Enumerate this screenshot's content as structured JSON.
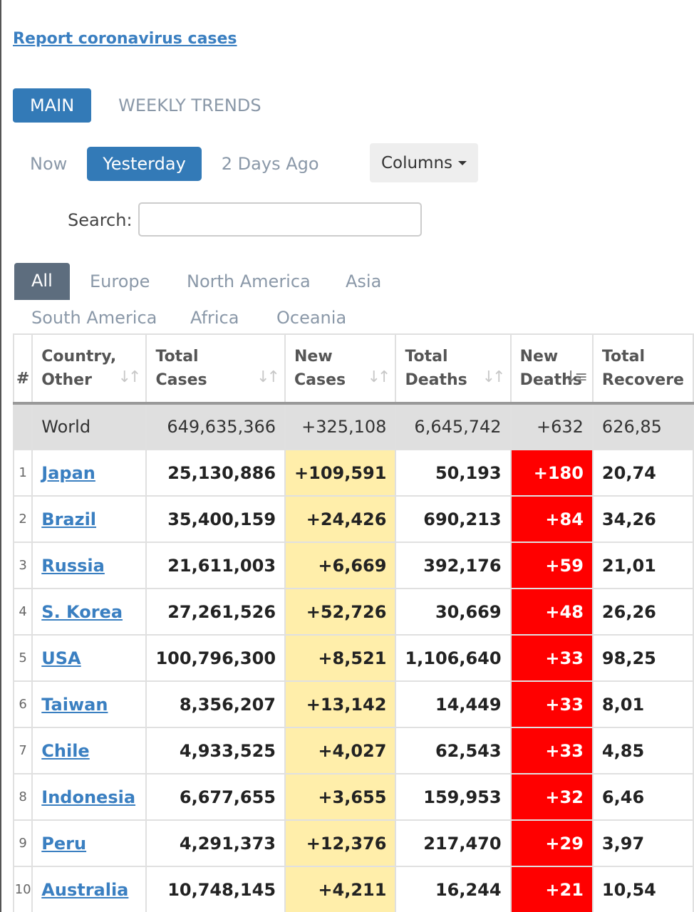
{
  "report_link": "Report coronavirus cases",
  "main_tabs": [
    "MAIN",
    "WEEKLY TRENDS"
  ],
  "day_tabs": [
    "Now",
    "Yesterday",
    "2 Days Ago"
  ],
  "columns_button": "Columns",
  "search": {
    "label": "Search:",
    "value": ""
  },
  "region_tabs": [
    "All",
    "Europe",
    "North America",
    "Asia",
    "South America",
    "Africa",
    "Oceania"
  ],
  "table": {
    "headers": {
      "rank": "#",
      "country": [
        "Country,",
        "Other"
      ],
      "total_cases": [
        "Total",
        "Cases"
      ],
      "new_cases": [
        "New",
        "Cases"
      ],
      "total_deaths": [
        "Total",
        "Deaths"
      ],
      "new_deaths": [
        "New",
        "Deaths"
      ],
      "total_recovered": [
        "Total",
        "Recovere"
      ]
    },
    "world": {
      "country": "World",
      "total_cases": "649,635,366",
      "new_cases": "+325,108",
      "total_deaths": "6,645,742",
      "new_deaths": "+632",
      "total_recovered": "626,85"
    },
    "rows": [
      {
        "rank": "1",
        "country": "Japan",
        "total_cases": "25,130,886",
        "new_cases": "+109,591",
        "total_deaths": "50,193",
        "new_deaths": "+180",
        "total_recovered": "20,74"
      },
      {
        "rank": "2",
        "country": "Brazil",
        "total_cases": "35,400,159",
        "new_cases": "+24,426",
        "total_deaths": "690,213",
        "new_deaths": "+84",
        "total_recovered": "34,26"
      },
      {
        "rank": "3",
        "country": "Russia",
        "total_cases": "21,611,003",
        "new_cases": "+6,669",
        "total_deaths": "392,176",
        "new_deaths": "+59",
        "total_recovered": "21,01"
      },
      {
        "rank": "4",
        "country": "S. Korea",
        "total_cases": "27,261,526",
        "new_cases": "+52,726",
        "total_deaths": "30,669",
        "new_deaths": "+48",
        "total_recovered": "26,26"
      },
      {
        "rank": "5",
        "country": "USA",
        "total_cases": "100,796,300",
        "new_cases": "+8,521",
        "total_deaths": "1,106,640",
        "new_deaths": "+33",
        "total_recovered": "98,25"
      },
      {
        "rank": "6",
        "country": "Taiwan",
        "total_cases": "8,356,207",
        "new_cases": "+13,142",
        "total_deaths": "14,449",
        "new_deaths": "+33",
        "total_recovered": "8,01"
      },
      {
        "rank": "7",
        "country": "Chile",
        "total_cases": "4,933,525",
        "new_cases": "+4,027",
        "total_deaths": "62,543",
        "new_deaths": "+33",
        "total_recovered": "4,85"
      },
      {
        "rank": "8",
        "country": "Indonesia",
        "total_cases": "6,677,655",
        "new_cases": "+3,655",
        "total_deaths": "159,953",
        "new_deaths": "+32",
        "total_recovered": "6,46"
      },
      {
        "rank": "9",
        "country": "Peru",
        "total_cases": "4,291,373",
        "new_cases": "+12,376",
        "total_deaths": "217,470",
        "new_deaths": "+29",
        "total_recovered": "3,97"
      },
      {
        "rank": "10",
        "country": "Australia",
        "total_cases": "10,748,145",
        "new_cases": "+4,211",
        "total_deaths": "16,244",
        "new_deaths": "+21",
        "total_recovered": "10,54"
      }
    ]
  },
  "colors": {
    "accent": "#337ab7",
    "new_cases_bg": "#ffeeaa",
    "new_deaths_bg": "#ff0000",
    "world_row_bg": "#dfdfdf"
  },
  "icons": {
    "sort": "sort-arrows-icon",
    "sort_active": "sort-desc-icon"
  }
}
